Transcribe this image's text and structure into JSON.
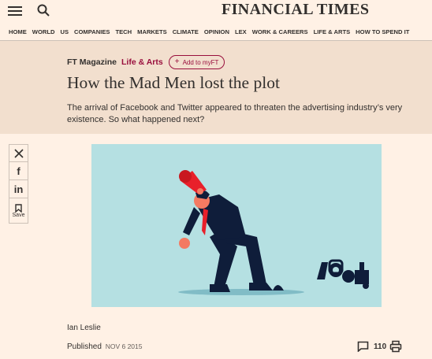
{
  "brand": "FINANCIAL TIMES",
  "nav": [
    "HOME",
    "WORLD",
    "US",
    "COMPANIES",
    "TECH",
    "MARKETS",
    "CLIMATE",
    "OPINION",
    "LEX",
    "WORK & CAREERS",
    "LIFE & ARTS",
    "HOW TO SPEND IT"
  ],
  "article": {
    "kicker": "FT Magazine",
    "section": "Life & Arts",
    "add_label": "Add to myFT",
    "headline": "How the Mad Men lost the plot",
    "standfirst": "The arrival of Facebook and Twitter appeared to threaten the advertising industry’s very existence. So what happened next?",
    "author": "Ian Leslie",
    "published_label": "Published",
    "published_date": "NOV 6 2015",
    "comment_count": "110"
  },
  "share": {
    "x_icon": "x-icon",
    "facebook": "f",
    "linkedin": "in",
    "save_label": "Save"
  },
  "illustration": {
    "icon": "man-with-megaphone-illustration",
    "background": "#b5e0e2"
  },
  "colors": {
    "page": "#fff1e5",
    "hero": "#f2dfce",
    "claret": "#990f3d",
    "text": "#33302e"
  }
}
